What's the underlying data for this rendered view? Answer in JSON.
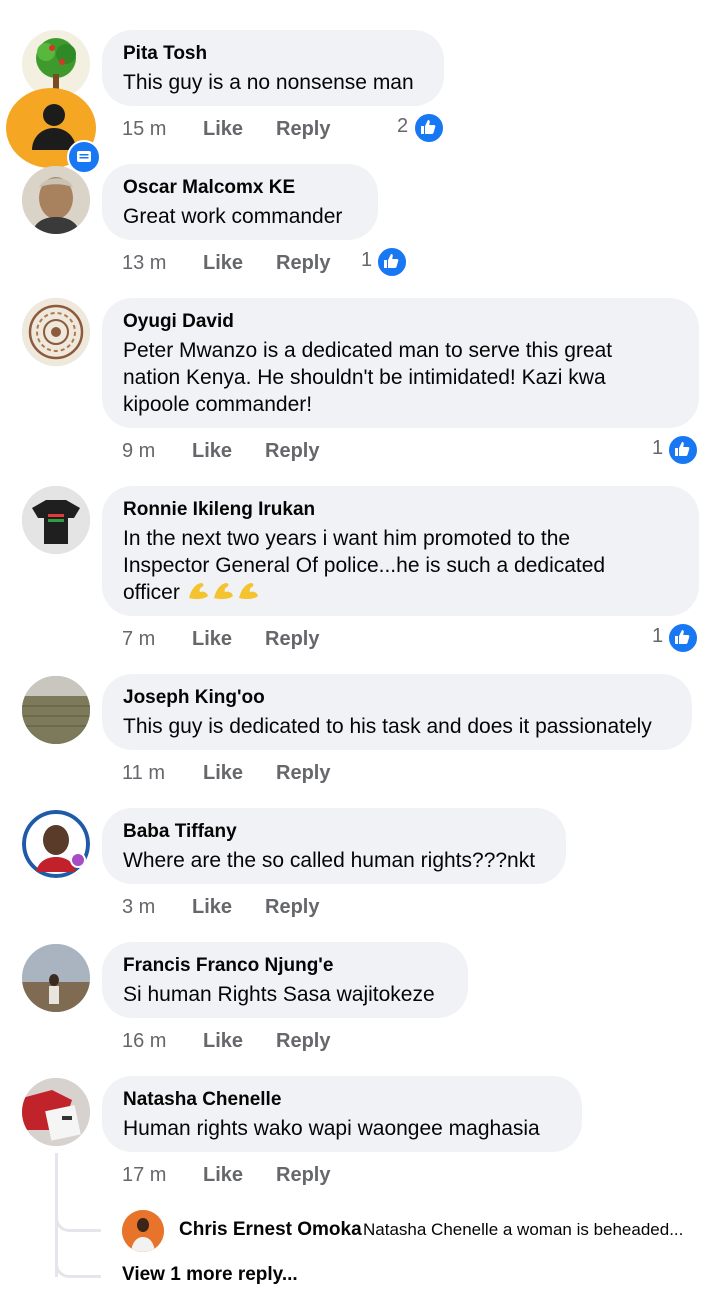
{
  "comments": [
    {
      "author": "Pita Tosh",
      "text": "This guy is a no nonsense man",
      "time": "15 m",
      "like": "Like",
      "reply": "Reply",
      "likes": "2"
    },
    {
      "author": "Oscar Malcomx KE",
      "text": "Great work commander",
      "time": "13 m",
      "like": "Like",
      "reply": "Reply",
      "likes": "1"
    },
    {
      "author": "Oyugi David",
      "text_lines": [
        "Peter Mwanzo is a dedicated man to serve this great",
        "nation Kenya. He shouldn't be intimidated! Kazi kwa",
        "kipoole commander!"
      ],
      "time": "9 m",
      "like": "Like",
      "reply": "Reply",
      "likes": "1"
    },
    {
      "author": "Ronnie Ikileng Irukan",
      "text_lines": [
        "In the next two years i want him promoted to the",
        "Inspector General Of police...he is such a dedicated",
        "officer"
      ],
      "time": "7 m",
      "like": "Like",
      "reply": "Reply",
      "likes": "1"
    },
    {
      "author": "Joseph King'oo",
      "text": "This guy is dedicated to his task and does it passionately",
      "time": "11 m",
      "like": "Like",
      "reply": "Reply"
    },
    {
      "author": "Baba Tiffany",
      "text": "Where are the so called human rights???nkt",
      "time": "3 m",
      "like": "Like",
      "reply": "Reply"
    },
    {
      "author": "Francis Franco Njung'e",
      "text": "Si human Rights Sasa wajitokeze",
      "time": "16 m",
      "like": "Like",
      "reply": "Reply"
    },
    {
      "author": "Natasha Chenelle",
      "text": "Human rights wako wapi waongee maghasia",
      "time": "17 m",
      "like": "Like",
      "reply": "Reply"
    }
  ],
  "reply_preview": {
    "author": "Chris Ernest Omoka",
    "text": "Natasha Chenelle a woman is beheaded..."
  },
  "view_more": "View 1 more reply...",
  "colors": {
    "bubble": "#f0f2f5",
    "like_blue": "#1877f2",
    "meta": "#65676b",
    "chathead": "#f5a623"
  }
}
